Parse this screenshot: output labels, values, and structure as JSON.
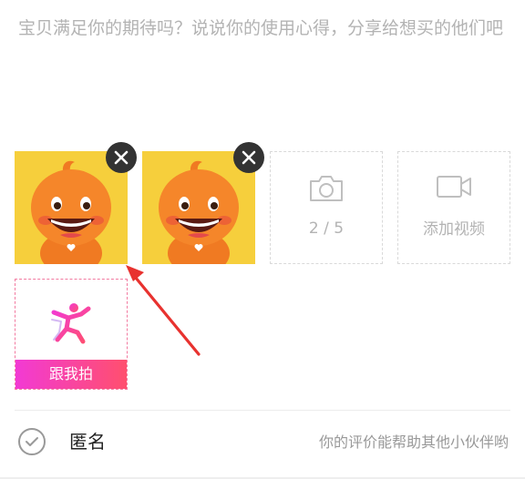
{
  "review": {
    "placeholder": "宝贝满足你的期待吗？说说你的使用心得，分享给想买的他们吧"
  },
  "media": {
    "photos": [
      {
        "icon": "photo-thumbnail",
        "remove_icon": "close-icon"
      },
      {
        "icon": "photo-thumbnail",
        "remove_icon": "close-icon"
      }
    ],
    "add_photo": {
      "icon": "camera-icon",
      "counter": "2 / 5"
    },
    "add_video": {
      "icon": "video-camera-icon",
      "label": "添加视频"
    },
    "follow_me": {
      "icon": "dancer-icon",
      "label": "跟我拍"
    }
  },
  "footer": {
    "anonymous_label": "匿名",
    "anonymous_checked": false,
    "help_text": "你的评价能帮助其他小伙伴哟"
  },
  "colors": {
    "placeholder": "#b3b3b3",
    "follow_gradient_start": "#f23ad4",
    "follow_gradient_end": "#ff4f6e",
    "annotation_arrow": "#e8322f"
  }
}
